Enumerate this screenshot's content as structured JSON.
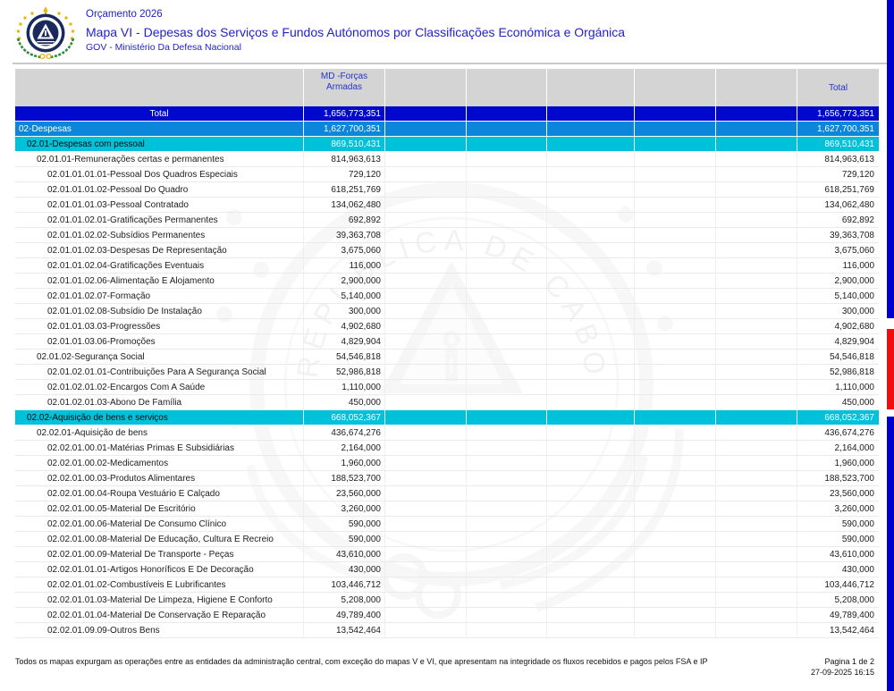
{
  "header": {
    "budget": "Orçamento 2026",
    "title": "Mapa VI - Depesas dos Serviços e Fundos Autónomos por Classificações Económica e Orgánica",
    "entity": "GOV - Ministério Da Defesa Nacional",
    "logo": "cabo-verde-national-emblem"
  },
  "watermark": {
    "arc_text": "REPUBLICA DE CABO VERDE"
  },
  "table": {
    "column_headers": {
      "md": "MD -Forças Armadas",
      "total": "Total"
    },
    "rows": [
      {
        "label": "Total",
        "style": "total",
        "level": 0,
        "md": "1,656,773,351",
        "total": "1,656,773,351"
      },
      {
        "label": "02-Despesas",
        "style": "chapter",
        "level": 1,
        "md": "1,627,700,351",
        "total": "1,627,700,351"
      },
      {
        "label": "02.01-Despesas com pessoal",
        "style": "group",
        "level": 2,
        "md": "869,510,431",
        "total": "869,510,431"
      },
      {
        "label": "02.01.01-Remunerações certas e permanentes",
        "style": "data",
        "level": 3,
        "md": "814,963,613",
        "total": "814,963,613"
      },
      {
        "label": "02.01.01.01.01-Pessoal Dos Quadros Especiais",
        "style": "data",
        "level": 4,
        "md": "729,120",
        "total": "729,120"
      },
      {
        "label": "02.01.01.01.02-Pessoal Do Quadro",
        "style": "data",
        "level": 4,
        "md": "618,251,769",
        "total": "618,251,769"
      },
      {
        "label": "02.01.01.01.03-Pessoal Contratado",
        "style": "data",
        "level": 4,
        "md": "134,062,480",
        "total": "134,062,480"
      },
      {
        "label": "02.01.01.02.01-Gratificações Permanentes",
        "style": "data",
        "level": 4,
        "md": "692,892",
        "total": "692,892"
      },
      {
        "label": "02.01.01.02.02-Subsídios Permanentes",
        "style": "data",
        "level": 4,
        "md": "39,363,708",
        "total": "39,363,708"
      },
      {
        "label": "02.01.01.02.03-Despesas De Representação",
        "style": "data",
        "level": 4,
        "md": "3,675,060",
        "total": "3,675,060"
      },
      {
        "label": "02.01.01.02.04-Gratificações Eventuais",
        "style": "data",
        "level": 4,
        "md": "116,000",
        "total": "116,000"
      },
      {
        "label": "02.01.01.02.06-Alimentação E Alojamento",
        "style": "data",
        "level": 4,
        "md": "2,900,000",
        "total": "2,900,000"
      },
      {
        "label": "02.01.01.02.07-Formação",
        "style": "data",
        "level": 4,
        "md": "5,140,000",
        "total": "5,140,000"
      },
      {
        "label": "02.01.01.02.08-Subsídio De Instalação",
        "style": "data",
        "level": 4,
        "md": "300,000",
        "total": "300,000"
      },
      {
        "label": "02.01.01.03.03-Progressões",
        "style": "data",
        "level": 4,
        "md": "4,902,680",
        "total": "4,902,680"
      },
      {
        "label": "02.01.01.03.06-Promoções",
        "style": "data",
        "level": 4,
        "md": "4,829,904",
        "total": "4,829,904"
      },
      {
        "label": "02.01.02-Segurança Social",
        "style": "data",
        "level": 3,
        "md": "54,546,818",
        "total": "54,546,818"
      },
      {
        "label": "02.01.02.01.01-Contribuições Para A Segurança Social",
        "style": "data",
        "level": 4,
        "md": "52,986,818",
        "total": "52,986,818"
      },
      {
        "label": "02.01.02.01.02-Encargos Com A Saúde",
        "style": "data",
        "level": 4,
        "md": "1,110,000",
        "total": "1,110,000"
      },
      {
        "label": "02.01.02.01.03-Abono De Família",
        "style": "data",
        "level": 4,
        "md": "450,000",
        "total": "450,000"
      },
      {
        "label": "02.02-Aquisição de bens e serviços",
        "style": "group",
        "level": 2,
        "md": "668,052,367",
        "total": "668,052,367"
      },
      {
        "label": "02.02.01-Aquisição de bens",
        "style": "data",
        "level": 3,
        "md": "436,674,276",
        "total": "436,674,276"
      },
      {
        "label": "02.02.01.00.01-Matérias Primas E Subsidiárias",
        "style": "data",
        "level": 4,
        "md": "2,164,000",
        "total": "2,164,000"
      },
      {
        "label": "02.02.01.00.02-Medicamentos",
        "style": "data",
        "level": 4,
        "md": "1,960,000",
        "total": "1,960,000"
      },
      {
        "label": "02.02.01.00.03-Produtos Alimentares",
        "style": "data",
        "level": 4,
        "md": "188,523,700",
        "total": "188,523,700"
      },
      {
        "label": "02.02.01.00.04-Roupa  Vestuário E Calçado",
        "style": "data",
        "level": 4,
        "md": "23,560,000",
        "total": "23,560,000"
      },
      {
        "label": "02.02.01.00.05-Material De Escritório",
        "style": "data",
        "level": 4,
        "md": "3,260,000",
        "total": "3,260,000"
      },
      {
        "label": "02.02.01.00.06-Material De Consumo Clínico",
        "style": "data",
        "level": 4,
        "md": "590,000",
        "total": "590,000"
      },
      {
        "label": "02.02.01.00.08-Material De Educação, Cultura E Recreio",
        "style": "data",
        "level": 4,
        "md": "590,000",
        "total": "590,000"
      },
      {
        "label": "02.02.01.00.09-Material De Transporte - Peças",
        "style": "data",
        "level": 4,
        "md": "43,610,000",
        "total": "43,610,000"
      },
      {
        "label": "02.02.01.01.01-Artigos Honoríficos E De Decoração",
        "style": "data",
        "level": 4,
        "md": "430,000",
        "total": "430,000"
      },
      {
        "label": "02.02.01.01.02-Combustíveis E Lubrificantes",
        "style": "data",
        "level": 4,
        "md": "103,446,712",
        "total": "103,446,712"
      },
      {
        "label": "02.02.01.01.03-Material De Limpeza, Higiene E Conforto",
        "style": "data",
        "level": 4,
        "md": "5,208,000",
        "total": "5,208,000"
      },
      {
        "label": "02.02.01.01.04-Material De Conservação E Reparação",
        "style": "data",
        "level": 4,
        "md": "49,789,400",
        "total": "49,789,400"
      },
      {
        "label": "02.02.01.09.09-Outros Bens",
        "style": "data",
        "level": 4,
        "md": "13,542,464",
        "total": "13,542,464"
      }
    ]
  },
  "footer": {
    "note": "Todos os mapas expurgam as operações entre as entidades da administração central, com exceção do mapas V e VI, que apresentam na integridade os fluxos recebidos e pagos pelos FSA e IP",
    "page": "Pagina 1 de 2",
    "datetime": "27-09-2025 16:15"
  },
  "colors": {
    "title_text": "#2221cf",
    "header_bg": "#d4d4d4",
    "header_text": "#2233cc",
    "row_total_bg": "#0008cb",
    "row_chapter_bg": "#0b86da",
    "row_group_bg": "#00c1da",
    "edge_blue": "#0000cc",
    "edge_red": "#ee0e0e",
    "emblem_navy": "#1a2a5e",
    "emblem_gold": "#e8b90f",
    "emblem_green": "#2e8b3a"
  }
}
